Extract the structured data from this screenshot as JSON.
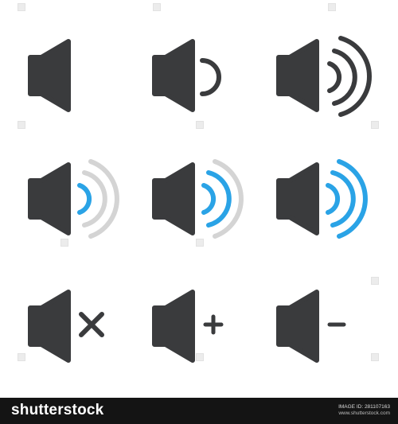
{
  "colors": {
    "speaker": "#3a3b3d",
    "wave_active": "#2aa3e6",
    "wave_inactive": "#d4d4d4",
    "footer_bg": "#141414"
  },
  "icons": [
    {
      "name": "speaker-muted-icon"
    },
    {
      "name": "speaker-low-icon"
    },
    {
      "name": "speaker-high-icon"
    },
    {
      "name": "speaker-level-1-icon"
    },
    {
      "name": "speaker-level-2-icon"
    },
    {
      "name": "speaker-level-3-icon"
    },
    {
      "name": "speaker-mute-x-icon"
    },
    {
      "name": "speaker-volume-up-icon"
    },
    {
      "name": "speaker-volume-down-icon"
    }
  ],
  "footer": {
    "logo": "shutterstock",
    "image_id": "IMAGE ID: 281107163",
    "site": "www.shutterstock.com"
  }
}
